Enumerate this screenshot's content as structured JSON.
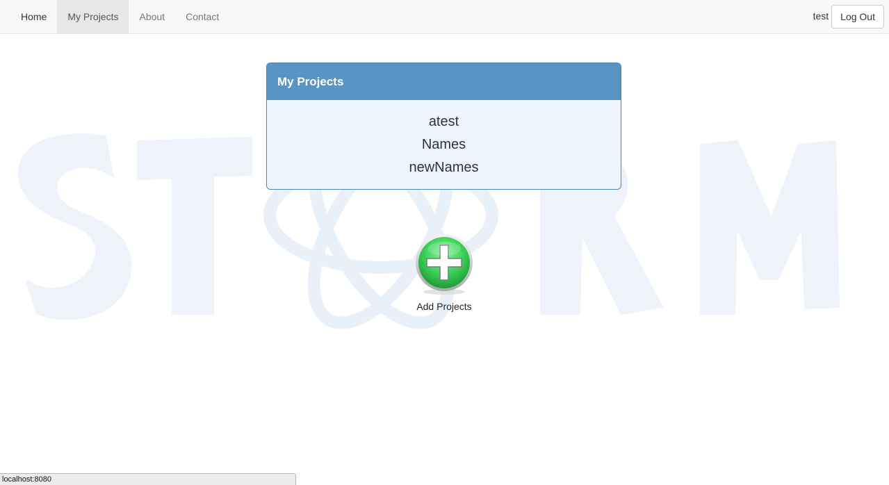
{
  "navbar": {
    "items": [
      {
        "label": "Home"
      },
      {
        "label": "My Projects",
        "active": true
      },
      {
        "label": "About"
      },
      {
        "label": "Contact"
      }
    ],
    "username": "test",
    "logout_label": "Log Out"
  },
  "background": {
    "watermark_text": "STORM",
    "watermark_color": "#eef3fa"
  },
  "projects_panel": {
    "title": "My Projects",
    "projects": [
      "atest",
      "Names",
      "newNames"
    ],
    "header_color": "#5895c2"
  },
  "add_project": {
    "label": "Add Projects",
    "icon": "green-plus-icon",
    "color": "#3cd35a"
  },
  "status_bar": {
    "text": "localhost:8080"
  }
}
